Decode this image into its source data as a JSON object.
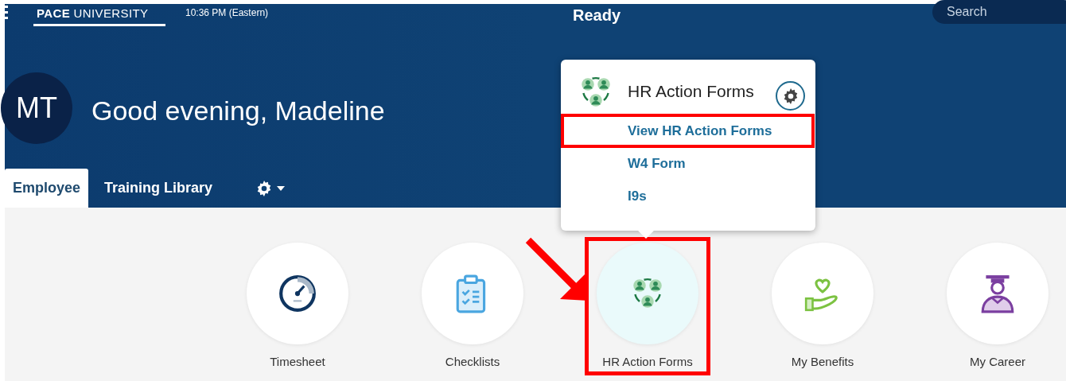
{
  "header": {
    "logo": "**PACE** UNIVERSITY",
    "time": "10:36 PM (Eastern)",
    "title": "Ready",
    "search": {
      "placeholder": "Search"
    }
  },
  "user": {
    "initials": "MT",
    "greeting": "Good evening, Madeline"
  },
  "tabs": [
    {
      "label": "Employee",
      "selected": true
    },
    {
      "label": "Training Library",
      "selected": false
    }
  ],
  "popover": {
    "title": "HR Action Forms",
    "items": [
      {
        "label": "View HR Action Forms",
        "highlighted": true
      },
      {
        "label": "W4 Form",
        "highlighted": false
      },
      {
        "label": "I9s",
        "highlighted": false
      }
    ]
  },
  "tiles": [
    {
      "label": "Timesheet",
      "kind": "gauge",
      "selected": false,
      "highlighted": false
    },
    {
      "label": "Checklists",
      "kind": "clipboard",
      "selected": false,
      "highlighted": false
    },
    {
      "label": "HR Action Forms",
      "kind": "people",
      "selected": true,
      "highlighted": true
    },
    {
      "label": "My Benefits",
      "kind": "hand-heart",
      "selected": false,
      "highlighted": false
    },
    {
      "label": "My Career",
      "kind": "graduate",
      "selected": false,
      "highlighted": false
    }
  ]
}
